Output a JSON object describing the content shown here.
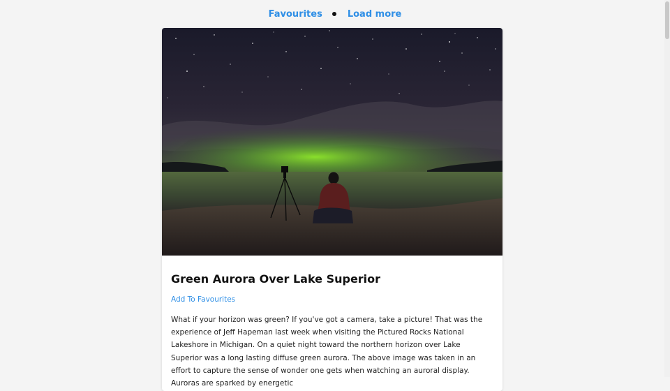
{
  "nav": {
    "favourites_label": "Favourites",
    "load_more_label": "Load more"
  },
  "card": {
    "image_alt": "Green aurora over Lake Superior with a seated photographer and tripod on the beach",
    "title": "Green Aurora Over Lake Superior",
    "add_favourites_label": "Add To Favourites",
    "description": "What if your horizon was green? If you've got a camera, take a picture! That was the experience of Jeff Hapeman last week when visiting the Pictured Rocks National Lakeshore in Michigan. On a quiet night toward the northern horizon over Lake Superior was a long lasting diffuse green aurora. The above image was taken in an effort to capture the sense of wonder one gets when watching an auroral display. Auroras are sparked by energetic"
  },
  "colors": {
    "link": "#2f8fe6",
    "page_bg": "#f4f4f4",
    "card_bg": "#ffffff"
  }
}
